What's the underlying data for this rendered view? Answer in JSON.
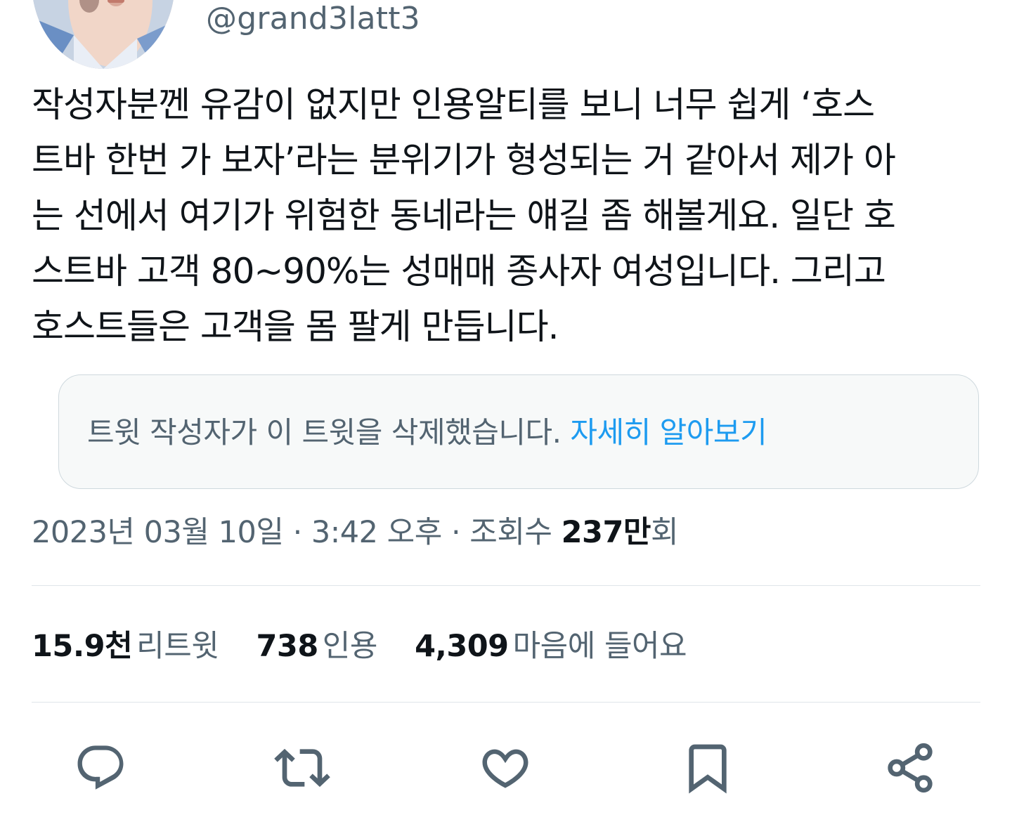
{
  "author": {
    "handle": "@grand3latt3"
  },
  "tweet": {
    "lines": [
      "작성자분껜 유감이 없지만 인용알티를 보니 너무 쉽게 ‘호스",
      "트바 한번 가 보자’라는 분위기가 형성되는 거 같아서 제가 아",
      "는 선에서 여기가 위험한 동네라는 얘길 좀 해볼게요. 일단 호",
      "스트바 고객 80~90%는 성매매 종사자 여성입니다. 그리고",
      "호스트들은 고객을 몸 팔게 만듭니다."
    ]
  },
  "quoted": {
    "deleted_message": "트윗 작성자가 이 트윗을 삭제했습니다.",
    "learn_more": "자세히 알아보기"
  },
  "meta": {
    "date": "2023년 03월 10일",
    "separator": "·",
    "time": "3:42 오후",
    "views_label": "조회수",
    "views_count": "237만",
    "views_suffix": "회"
  },
  "stats": {
    "retweets": {
      "count": "15.9천",
      "label": "리트윗"
    },
    "quotes": {
      "count": "738",
      "label": "인용"
    },
    "likes": {
      "count": "4,309",
      "label": "마음에 들어요"
    }
  },
  "actions": [
    {
      "icon": "reply-icon"
    },
    {
      "icon": "retweet-icon"
    },
    {
      "icon": "like-icon"
    },
    {
      "icon": "bookmark-icon"
    },
    {
      "icon": "share-icon"
    }
  ],
  "colors": {
    "text_primary": "#0f1419",
    "text_secondary": "#536471",
    "link": "#1d9bf0",
    "border": "#cfd9de",
    "quoted_bg": "#f7f9f9",
    "divider": "#dfe5e9"
  }
}
